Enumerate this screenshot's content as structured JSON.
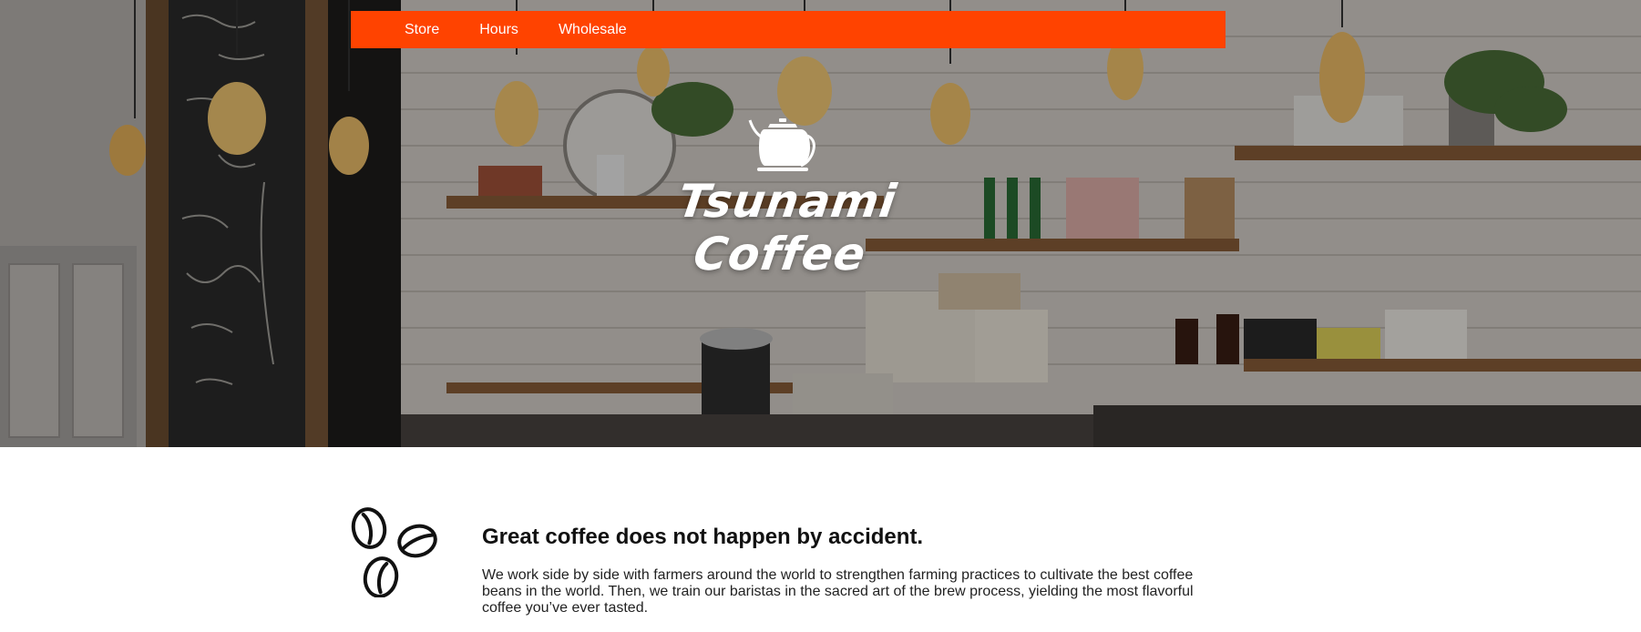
{
  "nav": {
    "items": [
      {
        "label": "Store"
      },
      {
        "label": "Hours"
      },
      {
        "label": "Wholesale"
      }
    ],
    "bg_color": "#ff4300"
  },
  "hero": {
    "brand_line1": "Tsunami",
    "brand_line2": "Coffee",
    "icon": "kettle-icon",
    "background": "cafe-interior-photo"
  },
  "info": {
    "icon": "coffee-beans-icon",
    "heading": "Great coffee does not happen by accident.",
    "body": "We work side by side with farmers around the world to strengthen farming practices to cultivate the best coffee beans in the world. Then, we train our baristas in the sacred art of the brew process, yielding the most flavorful coffee you’ve ever tasted."
  }
}
